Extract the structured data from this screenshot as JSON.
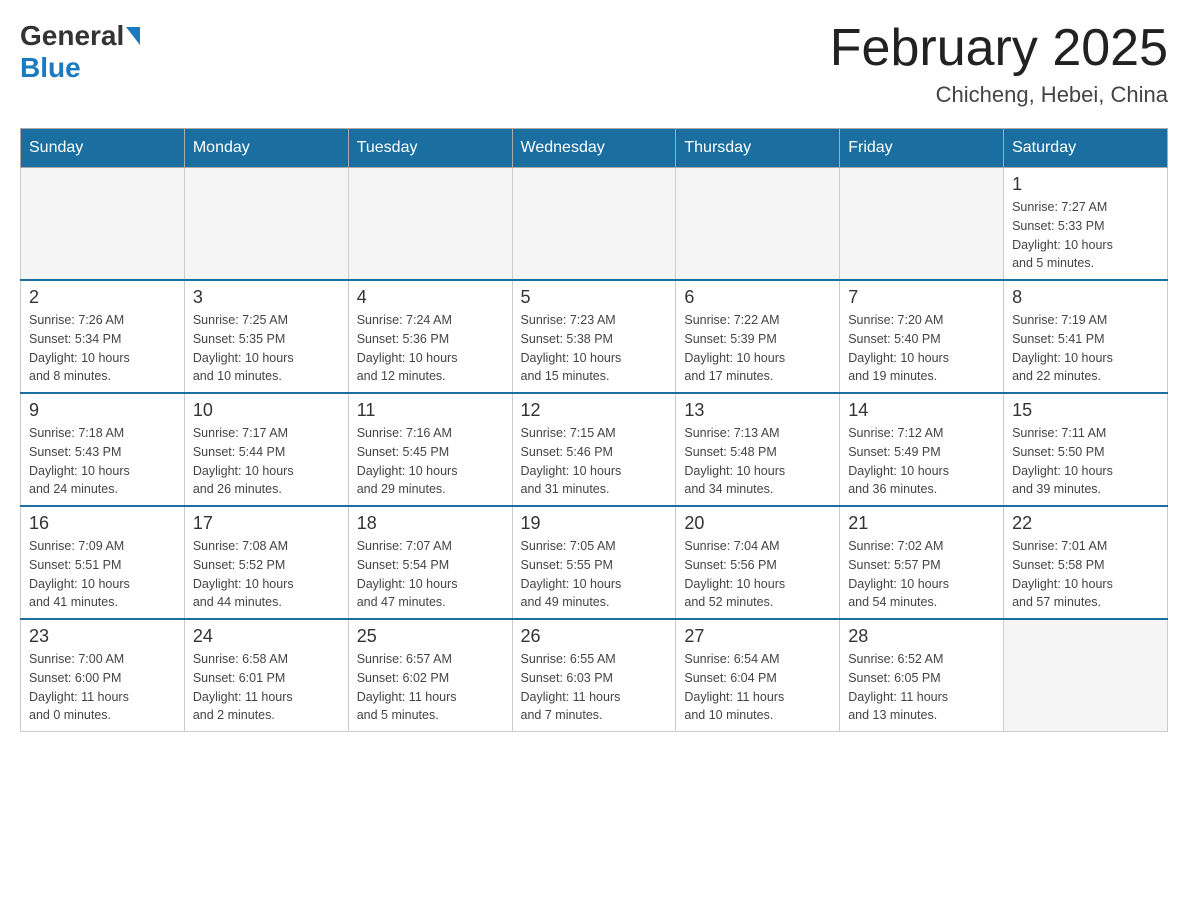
{
  "header": {
    "logo_general": "General",
    "logo_blue": "Blue",
    "month_title": "February 2025",
    "location": "Chicheng, Hebei, China"
  },
  "days_of_week": [
    "Sunday",
    "Monday",
    "Tuesday",
    "Wednesday",
    "Thursday",
    "Friday",
    "Saturday"
  ],
  "weeks": [
    [
      {
        "day": "",
        "info": ""
      },
      {
        "day": "",
        "info": ""
      },
      {
        "day": "",
        "info": ""
      },
      {
        "day": "",
        "info": ""
      },
      {
        "day": "",
        "info": ""
      },
      {
        "day": "",
        "info": ""
      },
      {
        "day": "1",
        "info": "Sunrise: 7:27 AM\nSunset: 5:33 PM\nDaylight: 10 hours\nand 5 minutes."
      }
    ],
    [
      {
        "day": "2",
        "info": "Sunrise: 7:26 AM\nSunset: 5:34 PM\nDaylight: 10 hours\nand 8 minutes."
      },
      {
        "day": "3",
        "info": "Sunrise: 7:25 AM\nSunset: 5:35 PM\nDaylight: 10 hours\nand 10 minutes."
      },
      {
        "day": "4",
        "info": "Sunrise: 7:24 AM\nSunset: 5:36 PM\nDaylight: 10 hours\nand 12 minutes."
      },
      {
        "day": "5",
        "info": "Sunrise: 7:23 AM\nSunset: 5:38 PM\nDaylight: 10 hours\nand 15 minutes."
      },
      {
        "day": "6",
        "info": "Sunrise: 7:22 AM\nSunset: 5:39 PM\nDaylight: 10 hours\nand 17 minutes."
      },
      {
        "day": "7",
        "info": "Sunrise: 7:20 AM\nSunset: 5:40 PM\nDaylight: 10 hours\nand 19 minutes."
      },
      {
        "day": "8",
        "info": "Sunrise: 7:19 AM\nSunset: 5:41 PM\nDaylight: 10 hours\nand 22 minutes."
      }
    ],
    [
      {
        "day": "9",
        "info": "Sunrise: 7:18 AM\nSunset: 5:43 PM\nDaylight: 10 hours\nand 24 minutes."
      },
      {
        "day": "10",
        "info": "Sunrise: 7:17 AM\nSunset: 5:44 PM\nDaylight: 10 hours\nand 26 minutes."
      },
      {
        "day": "11",
        "info": "Sunrise: 7:16 AM\nSunset: 5:45 PM\nDaylight: 10 hours\nand 29 minutes."
      },
      {
        "day": "12",
        "info": "Sunrise: 7:15 AM\nSunset: 5:46 PM\nDaylight: 10 hours\nand 31 minutes."
      },
      {
        "day": "13",
        "info": "Sunrise: 7:13 AM\nSunset: 5:48 PM\nDaylight: 10 hours\nand 34 minutes."
      },
      {
        "day": "14",
        "info": "Sunrise: 7:12 AM\nSunset: 5:49 PM\nDaylight: 10 hours\nand 36 minutes."
      },
      {
        "day": "15",
        "info": "Sunrise: 7:11 AM\nSunset: 5:50 PM\nDaylight: 10 hours\nand 39 minutes."
      }
    ],
    [
      {
        "day": "16",
        "info": "Sunrise: 7:09 AM\nSunset: 5:51 PM\nDaylight: 10 hours\nand 41 minutes."
      },
      {
        "day": "17",
        "info": "Sunrise: 7:08 AM\nSunset: 5:52 PM\nDaylight: 10 hours\nand 44 minutes."
      },
      {
        "day": "18",
        "info": "Sunrise: 7:07 AM\nSunset: 5:54 PM\nDaylight: 10 hours\nand 47 minutes."
      },
      {
        "day": "19",
        "info": "Sunrise: 7:05 AM\nSunset: 5:55 PM\nDaylight: 10 hours\nand 49 minutes."
      },
      {
        "day": "20",
        "info": "Sunrise: 7:04 AM\nSunset: 5:56 PM\nDaylight: 10 hours\nand 52 minutes."
      },
      {
        "day": "21",
        "info": "Sunrise: 7:02 AM\nSunset: 5:57 PM\nDaylight: 10 hours\nand 54 minutes."
      },
      {
        "day": "22",
        "info": "Sunrise: 7:01 AM\nSunset: 5:58 PM\nDaylight: 10 hours\nand 57 minutes."
      }
    ],
    [
      {
        "day": "23",
        "info": "Sunrise: 7:00 AM\nSunset: 6:00 PM\nDaylight: 11 hours\nand 0 minutes."
      },
      {
        "day": "24",
        "info": "Sunrise: 6:58 AM\nSunset: 6:01 PM\nDaylight: 11 hours\nand 2 minutes."
      },
      {
        "day": "25",
        "info": "Sunrise: 6:57 AM\nSunset: 6:02 PM\nDaylight: 11 hours\nand 5 minutes."
      },
      {
        "day": "26",
        "info": "Sunrise: 6:55 AM\nSunset: 6:03 PM\nDaylight: 11 hours\nand 7 minutes."
      },
      {
        "day": "27",
        "info": "Sunrise: 6:54 AM\nSunset: 6:04 PM\nDaylight: 11 hours\nand 10 minutes."
      },
      {
        "day": "28",
        "info": "Sunrise: 6:52 AM\nSunset: 6:05 PM\nDaylight: 11 hours\nand 13 minutes."
      },
      {
        "day": "",
        "info": ""
      }
    ]
  ]
}
